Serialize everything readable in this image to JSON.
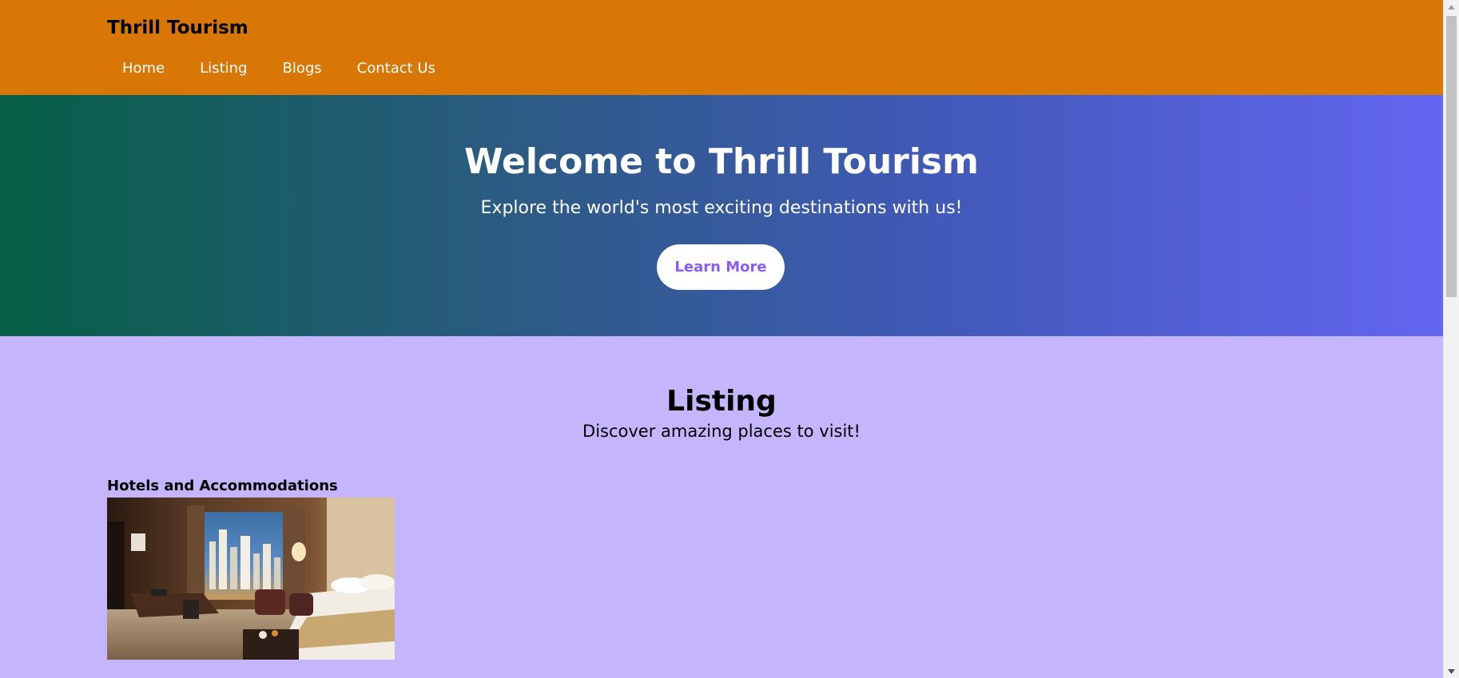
{
  "header": {
    "brand": "Thrill Tourism",
    "nav": [
      {
        "label": "Home"
      },
      {
        "label": "Listing"
      },
      {
        "label": "Blogs"
      },
      {
        "label": "Contact Us"
      }
    ]
  },
  "hero": {
    "title": "Welcome to Thrill Tourism",
    "subtitle": "Explore the world's most exciting destinations with us!",
    "button_label": "Learn More"
  },
  "listing": {
    "title": "Listing",
    "subtitle": "Discover amazing places to visit!",
    "cards": [
      {
        "title": "Hotels and Accommodations",
        "image": "hotel-room-photo"
      }
    ]
  },
  "colors": {
    "header_bg": "#d97706",
    "hero_gradient_start": "#065f46",
    "hero_gradient_end": "#6366f1",
    "listing_bg": "#c4b5fd",
    "button_text": "#8b5cf6"
  },
  "scrollbar": {
    "up_icon": "arrow-up-icon",
    "down_icon": "arrow-down-icon"
  }
}
